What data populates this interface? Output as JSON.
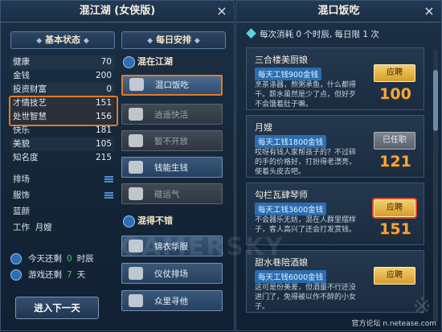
{
  "left_panel": {
    "title": "混江湖 (女侠版)",
    "close": "×",
    "status_header": "基本状态",
    "daily_header": "每日安排",
    "stats": [
      {
        "label": "健康",
        "value": "70"
      },
      {
        "label": "金钱",
        "value": "200"
      },
      {
        "label": "投资财富",
        "value": "0"
      },
      {
        "label": "才情技艺",
        "value": "151"
      },
      {
        "label": "处世智慧",
        "value": "156"
      },
      {
        "label": "快乐",
        "value": "181"
      },
      {
        "label": "美貌",
        "value": "105"
      },
      {
        "label": "知名度",
        "value": "215"
      }
    ],
    "misc": [
      {
        "label": "排场"
      },
      {
        "label": "服饰"
      },
      {
        "label": "蓝颜"
      },
      {
        "label": "工作",
        "value": "月嫂"
      }
    ],
    "counters": [
      {
        "label": "今天还剩",
        "value": "0",
        "unit": "时辰"
      },
      {
        "label": "游戏还剩",
        "value": "7",
        "unit": "天"
      }
    ],
    "next_day": "进入下一天",
    "group1": "混在江湖",
    "group1_items": [
      "混口饭吃",
      "逍遥快活",
      "暂不开放",
      "钱能生钱",
      "碰运气"
    ],
    "group2": "混得不错",
    "group2_items": [
      "锦衣华服",
      "仪仗排场",
      "众里寻他"
    ]
  },
  "right_panel": {
    "title": "混口饭吃",
    "close": "×",
    "consume": "每次消耗 0 个时辰, 每日限 1 次",
    "jobs": [
      {
        "name": "三合楼美厨娘",
        "pay": "每天工钱900金钱",
        "desc": "烹茶涤器，熬粥承鱼，什么都得干。薪水虽然是少了点，但好歹不会饿着肚子嘛。",
        "button": "应聘",
        "number": "100"
      },
      {
        "name": "月嫂",
        "pay": "每天工钱1800金钱",
        "desc": "哎呀有钱人家帮孩子的？不过碎的手的价格好，打扮得老漂亮，使着头皮去吧。",
        "button": "已任职",
        "number": "121"
      },
      {
        "name": "勾栏瓦肆琴师",
        "pay": "每天工钱3600金钱",
        "desc": "不会器乐无妨，混在人群里摆样子，客人高兴了还会打发赏钱。",
        "button": "应聘",
        "number": "151"
      },
      {
        "name": "甜水巷陪酒娘",
        "pay": "每天工钱6000金钱",
        "desc": "这可是份美差，但酒量不行还没进门了，免得被以作不醉的小女子。",
        "button": "应聘",
        "number": ""
      }
    ],
    "site_credit": "官方论坛 n.netease.com"
  },
  "watermark": "GAMERSKY",
  "colors": {
    "accent": "#e27a2a",
    "gold": "#f4a63a",
    "money": "#2a6db0"
  }
}
